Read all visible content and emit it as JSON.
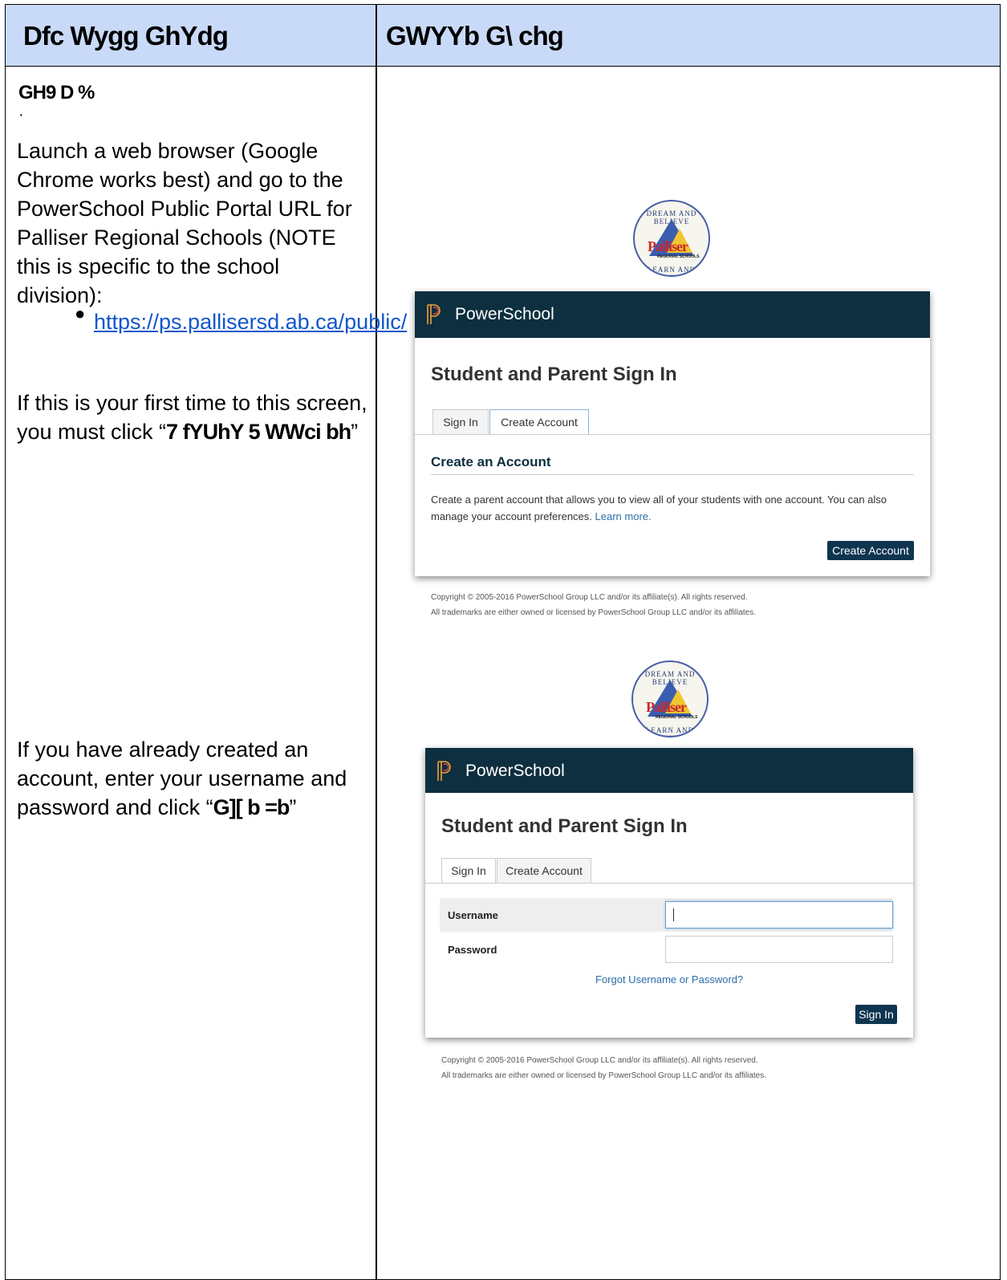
{
  "table": {
    "headers": [
      "Dfc Wygg GhYdg",
      "GWYYb G\\ chg"
    ],
    "step_label": "GH9 D %",
    "step_dot": "·",
    "para1": "Launch a web browser (Google Chrome works best) and go to the PowerSchool Public Portal URL for Palliser Regional Schools (NOTE this is specific to the school division):",
    "bullet": "●",
    "link": "https://ps.pallisersd.ab.ca/public/",
    "para2_prefix": "If this is your first time to this screen, you must click “",
    "para2_bold": "7 fYUhY 5 WWci bh",
    "para2_suffix": "”",
    "para3_prefix": "If you have already created an account, enter your username and password and click “",
    "para3_bold": "G][ b =b",
    "para3_suffix": "”"
  },
  "logo": {
    "top_text": "DREAM AND BELIEVE",
    "word": "Palliser",
    "sub": "REGIONAL SCHOOLS",
    "bottom_text": "LEARN AND ACHIEVE"
  },
  "shot1": {
    "brand": "PowerSchool",
    "title": "Student and Parent Sign In",
    "tabs": [
      "Sign In",
      "Create Account"
    ],
    "section": "Create an Account",
    "desc_text": "Create a parent account that allows you to view all of your students with one account. You can also manage your account preferences.",
    "desc_link": "Learn more.",
    "button": "Create Account",
    "copyright1": "Copyright © 2005-2016 PowerSchool Group LLC and/or its affiliate(s). All rights reserved.",
    "copyright2": "All trademarks are either owned or licensed by PowerSchool Group LLC and/or its affiliates."
  },
  "shot2": {
    "brand": "PowerSchool",
    "title": "Student and Parent Sign In",
    "tabs": [
      "Sign In",
      "Create Account"
    ],
    "username_label": "Username",
    "password_label": "Password",
    "forgot": "Forgot Username or Password?",
    "button": "Sign In",
    "copyright1": "Copyright © 2005-2016 PowerSchool Group LLC and/or its affiliate(s). All rights reserved.",
    "copyright2": "All trademarks are either owned or licensed by PowerSchool Group LLC and/or its affiliates."
  },
  "colors": {
    "header_bg": "#c9daf8",
    "powerschool_bar": "#0d2f40",
    "link": "#1155cc"
  }
}
